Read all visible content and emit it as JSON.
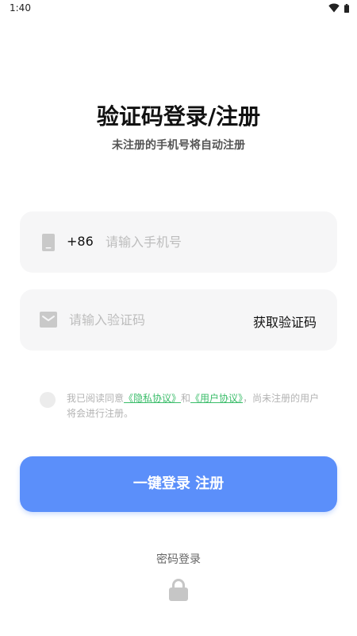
{
  "status_bar": {
    "time": "1:40",
    "wifi_icon": "wifi-icon",
    "battery_icon": "battery-icon"
  },
  "header": {
    "title": "验证码登录/注册",
    "subtitle": "未注册的手机号将自动注册"
  },
  "phone_field": {
    "icon": "phone-icon",
    "prefix": "+86",
    "placeholder": "请输入手机号",
    "value": ""
  },
  "code_field": {
    "icon": "mail-icon",
    "placeholder": "请输入验证码",
    "value": "",
    "get_code_label": "获取验证码"
  },
  "agreement": {
    "prefix": "我已阅读同意",
    "privacy_link": "《隐私协议》",
    "and": "和",
    "user_link": "《用户协议》",
    "suffix": "，尚未注册的用户将会进行注册。",
    "checked": false
  },
  "login_button": {
    "label": "一键登录 注册",
    "color": "#5b8ffa"
  },
  "password_login": {
    "label": "密码登录",
    "icon": "lock-icon"
  },
  "colors": {
    "link": "#3bbd6a",
    "field_bg": "#f6f6f7",
    "primary": "#5b8ffa"
  }
}
